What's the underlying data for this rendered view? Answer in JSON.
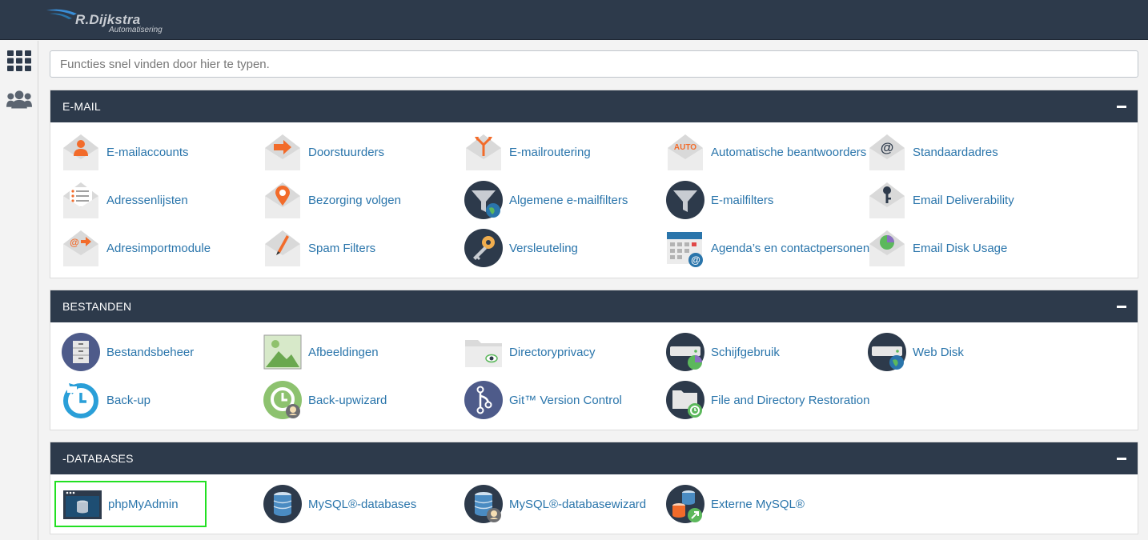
{
  "brand": {
    "name": "R.Dijkstra",
    "tagline": "Automatisering"
  },
  "search": {
    "placeholder": "Functies snel vinden door hier te typen."
  },
  "sidebar": {
    "items": [
      {
        "icon": "grid-icon"
      },
      {
        "icon": "users-icon"
      }
    ]
  },
  "colors": {
    "header": "#2d3a4b",
    "link": "#2a75ab",
    "highlight": "#22e022",
    "accent": "#f26b2a"
  },
  "sections": [
    {
      "title": "E-MAIL",
      "items": [
        {
          "label": "E-mailaccounts",
          "icon": "email-accounts-icon"
        },
        {
          "label": "Doorstuurders",
          "icon": "forwarders-icon"
        },
        {
          "label": "E-mailroutering",
          "icon": "email-routing-icon"
        },
        {
          "label": "Automatische beantwoorders",
          "icon": "autoresponders-icon",
          "badge": "AUTO"
        },
        {
          "label": "Standaardadres",
          "icon": "default-address-icon"
        },
        {
          "label": "Adressenlijsten",
          "icon": "mailing-lists-icon"
        },
        {
          "label": "Bezorging volgen",
          "icon": "track-delivery-icon"
        },
        {
          "label": "Algemene e-mailfilters",
          "icon": "global-email-filters-icon"
        },
        {
          "label": "E-mailfilters",
          "icon": "email-filters-icon"
        },
        {
          "label": "Email Deliverability",
          "icon": "email-deliverability-icon"
        },
        {
          "label": "Adresimportmodule",
          "icon": "address-importer-icon"
        },
        {
          "label": "Spam Filters",
          "icon": "spam-filters-icon"
        },
        {
          "label": "Versleuteling",
          "icon": "encryption-icon"
        },
        {
          "label": "Agenda’s en contactpersonen",
          "icon": "calendars-contacts-icon"
        },
        {
          "label": "Email Disk Usage",
          "icon": "email-disk-usage-icon"
        }
      ]
    },
    {
      "title": "BESTANDEN",
      "items": [
        {
          "label": "Bestandsbeheer",
          "icon": "file-manager-icon"
        },
        {
          "label": "Afbeeldingen",
          "icon": "images-icon"
        },
        {
          "label": "Directoryprivacy",
          "icon": "directory-privacy-icon"
        },
        {
          "label": "Schijfgebruik",
          "icon": "disk-usage-icon"
        },
        {
          "label": "Web Disk",
          "icon": "web-disk-icon"
        },
        {
          "label": "Back-up",
          "icon": "backup-icon"
        },
        {
          "label": "Back-upwizard",
          "icon": "backup-wizard-icon"
        },
        {
          "label": "Git™ Version Control",
          "icon": "git-version-control-icon"
        },
        {
          "label": "File and Directory Restoration",
          "icon": "file-restoration-icon"
        }
      ]
    },
    {
      "title": "-DATABASES",
      "items": [
        {
          "label": "phpMyAdmin",
          "icon": "phpmyadmin-icon",
          "highlighted": true
        },
        {
          "label": "MySQL®-databases",
          "icon": "mysql-databases-icon"
        },
        {
          "label": "MySQL®-databasewizard",
          "icon": "mysql-database-wizard-icon"
        },
        {
          "label": "Externe MySQL®",
          "icon": "remote-mysql-icon"
        }
      ]
    }
  ]
}
